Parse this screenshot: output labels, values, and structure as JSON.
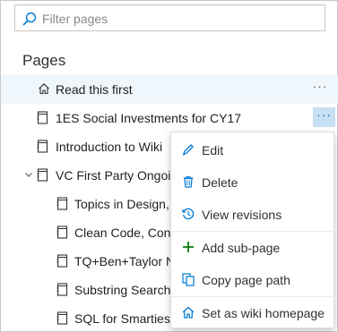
{
  "search": {
    "placeholder": "Filter pages",
    "value": ""
  },
  "pages_heading": "Pages",
  "tree": [
    {
      "label": "Read this first",
      "icon": "home-icon",
      "selected": true
    },
    {
      "label": "1ES Social Investments for CY17",
      "icon": "page-icon",
      "menu_open": true
    },
    {
      "label": "Introduction to Wiki",
      "icon": "page-icon"
    },
    {
      "label": "VC First Party Ongoin",
      "icon": "page-icon",
      "expanded": true
    },
    {
      "label": "Topics in Design, ...",
      "icon": "page-icon",
      "child": true
    },
    {
      "label": "Clean Code, Cong",
      "icon": "page-icon",
      "child": true
    },
    {
      "label": "TQ+Ben+Taylor N",
      "icon": "page-icon",
      "child": true
    },
    {
      "label": "Substring Search,",
      "icon": "page-icon",
      "child": true
    },
    {
      "label": "SQL for Smarties,",
      "icon": "page-icon",
      "child": true
    }
  ],
  "more_glyph": "···",
  "context_menu": {
    "edit": "Edit",
    "delete": "Delete",
    "view_revisions": "View revisions",
    "add_sub_page": "Add sub-page",
    "copy_page_path": "Copy page path",
    "set_as_home": "Set as wiki homepage"
  },
  "colors": {
    "accent": "#0078d4",
    "add_green": "#107c10",
    "selected_bg": "#eff6fc"
  }
}
